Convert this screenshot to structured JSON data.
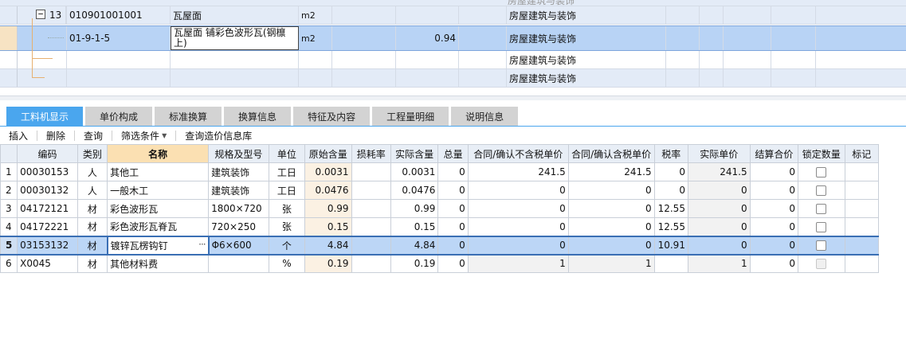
{
  "top_tree": {
    "partial_label": "房屋建筑与装饰",
    "rows": [
      {
        "no": "13",
        "code": "010901001001",
        "name": "瓦屋面",
        "unit": "m2",
        "qty": "",
        "category": "房屋建筑与装饰",
        "expander": "−"
      },
      {
        "no": "",
        "code": "01-9-1-5",
        "name": "瓦屋面 铺彩色波形瓦(钢檩上)",
        "unit": "m2",
        "qty": "0.94",
        "category": "房屋建筑与装饰"
      },
      {
        "no": "",
        "code": "",
        "name": "",
        "unit": "",
        "qty": "",
        "category": "房屋建筑与装饰"
      },
      {
        "no": "",
        "code": "",
        "name": "",
        "unit": "",
        "qty": "",
        "category": "房屋建筑与装饰"
      }
    ]
  },
  "tabs": [
    "工料机显示",
    "单价构成",
    "标准换算",
    "换算信息",
    "特征及内容",
    "工程量明细",
    "说明信息"
  ],
  "toolbar": {
    "insert": "插入",
    "delete": "删除",
    "query": "查询",
    "filter": "筛选条件",
    "price_query": "查询造价信息库"
  },
  "grid": {
    "headers": [
      "",
      "编码",
      "类别",
      "名称",
      "规格及型号",
      "单位",
      "原始含量",
      "损耗率",
      "实际含量",
      "总量",
      "合同/确认不含税单价",
      "合同/确认含税单价",
      "税率",
      "实际单价",
      "结算合价",
      "锁定数量",
      "标记"
    ],
    "rows": [
      {
        "idx": "1",
        "code": "00030153",
        "type": "人",
        "name": "其他工",
        "spec": "建筑装饰",
        "unit": "工日",
        "orig": "0.0031",
        "loss": "",
        "actual": "0.0031",
        "total": "0",
        "price_ex": "241.5",
        "price_in": "241.5",
        "tax": "0",
        "real_price": "241.5",
        "settle": "0",
        "mark": ""
      },
      {
        "idx": "2",
        "code": "00030132",
        "type": "人",
        "name": "一般木工",
        "spec": "建筑装饰",
        "unit": "工日",
        "orig": "0.0476",
        "loss": "",
        "actual": "0.0476",
        "total": "0",
        "price_ex": "0",
        "price_in": "0",
        "tax": "0",
        "real_price": "0",
        "settle": "0",
        "mark": ""
      },
      {
        "idx": "3",
        "code": "04172121",
        "type": "材",
        "name": "彩色波形瓦",
        "spec": "1800×720",
        "unit": "张",
        "orig": "0.99",
        "loss": "",
        "actual": "0.99",
        "total": "0",
        "price_ex": "0",
        "price_in": "0",
        "tax": "12.55",
        "real_price": "0",
        "settle": "0",
        "mark": ""
      },
      {
        "idx": "4",
        "code": "04172221",
        "type": "材",
        "name": "彩色波形瓦脊瓦",
        "spec": "720×250",
        "unit": "张",
        "orig": "0.15",
        "loss": "",
        "actual": "0.15",
        "total": "0",
        "price_ex": "0",
        "price_in": "0",
        "tax": "12.55",
        "real_price": "0",
        "settle": "0",
        "mark": ""
      },
      {
        "idx": "5",
        "code": "03153132",
        "type": "材",
        "name": "镀锌瓦楞钩钉",
        "spec": "Φ6×600",
        "unit": "个",
        "orig": "4.84",
        "loss": "",
        "actual": "4.84",
        "total": "0",
        "price_ex": "0",
        "price_in": "0",
        "tax": "10.91",
        "real_price": "0",
        "settle": "0",
        "mark": ""
      },
      {
        "idx": "6",
        "code": "X0045",
        "type": "材",
        "name": "其他材料费",
        "spec": "",
        "unit": "%",
        "orig": "0.19",
        "loss": "",
        "actual": "0.19",
        "total": "0",
        "price_ex": "1",
        "price_in": "1",
        "tax": "",
        "real_price": "1",
        "settle": "0",
        "mark": ""
      }
    ],
    "ellipsis": "···"
  },
  "colors": {
    "tab_active": "#4aa6ee",
    "selected_row": "#bcd6f6",
    "header_highlight": "#fbe0b2"
  }
}
